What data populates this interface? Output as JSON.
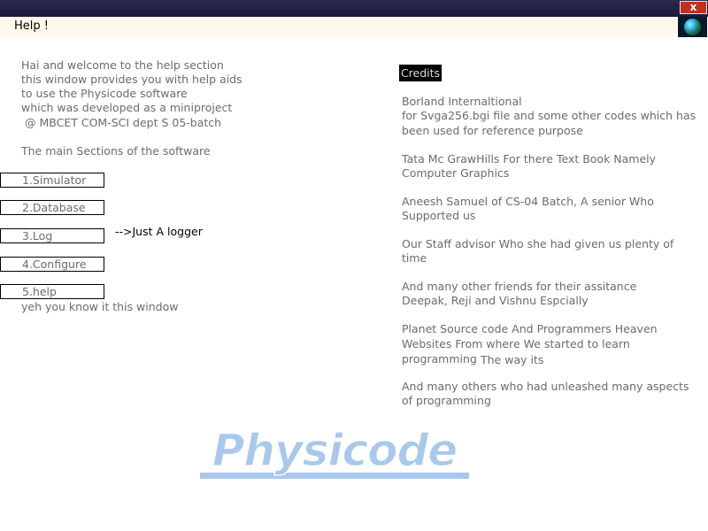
{
  "window": {
    "title": "Help !",
    "close_label": "x"
  },
  "intro": {
    "lines": [
      "Hai and welcome to the help section",
      "this window provides you with help aids",
      "to use the Physicode software",
      "which was developed as a miniproject",
      "@ MBCET COM-SCI dept S  05-batch"
    ],
    "sections_heading": "The main Sections of the software"
  },
  "sections": [
    {
      "label": "1.Simulator"
    },
    {
      "label": "2.Database"
    },
    {
      "label": "3.Log",
      "note": "-->Just A logger"
    },
    {
      "label": "4.Configure"
    },
    {
      "label": "5.help",
      "note": "yeh you know it this window"
    }
  ],
  "credits": {
    "button_label": "Credits",
    "entries": [
      [
        "Borland Internaltional",
        "for Svga256.bgi file and some other codes which has",
        "been used for reference purpose"
      ],
      [
        "Tata Mc GrawHills For there Text Book Namely",
        "Computer Graphics"
      ],
      [
        "Aneesh Samuel of CS-04 Batch, A senior Who",
        "Supported us"
      ],
      [
        "Our Staff advisor Who she had given us plenty of",
        "time"
      ],
      [
        "And many other friends for their assitance",
        "Deepak, Reji and Vishnu Espcially"
      ],
      [
        "Planet Source code And Programmers Heaven",
        "Websites From where We started to learn",
        "programming",
        "The way its"
      ],
      [
        "And many others who had unleashed many aspects",
        "of programming"
      ]
    ]
  },
  "logo": {
    "text": "Physicode",
    "color": "#a8c8ec"
  }
}
